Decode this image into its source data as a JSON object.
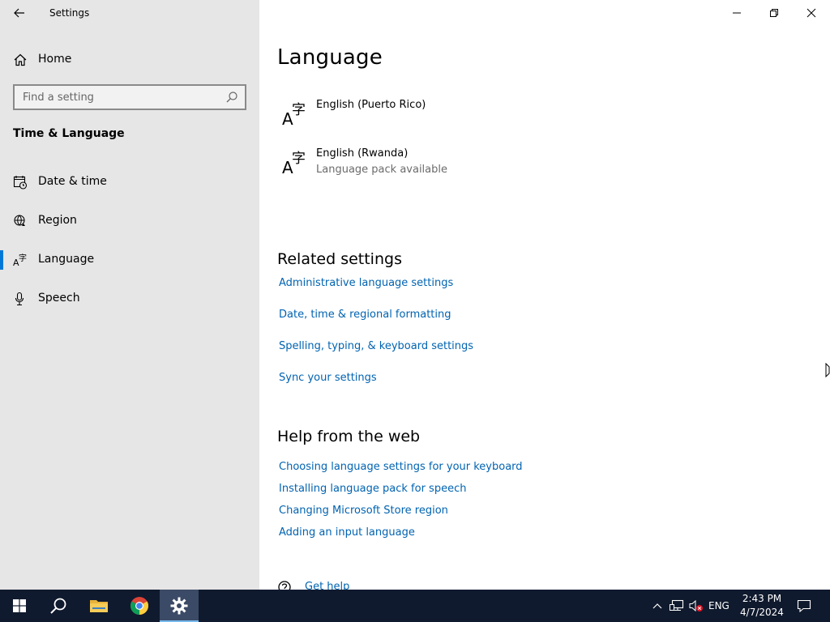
{
  "window": {
    "title": "Settings",
    "controls": {
      "minimize": "minimize",
      "maximize": "restore",
      "close": "close"
    }
  },
  "sidebar": {
    "home_label": "Home",
    "search_placeholder": "Find a setting",
    "section_title": "Time & Language",
    "items": [
      {
        "label": "Date & time",
        "icon": "calendar-clock-icon"
      },
      {
        "label": "Region",
        "icon": "globe-icon"
      },
      {
        "label": "Language",
        "icon": "language-icon",
        "active": true
      },
      {
        "label": "Speech",
        "icon": "microphone-icon"
      }
    ]
  },
  "main": {
    "title": "Language",
    "languages": [
      {
        "name": "English (Puerto Rico)",
        "subtitle": ""
      },
      {
        "name": "English (Rwanda)",
        "subtitle": "Language pack available"
      }
    ],
    "related": {
      "title": "Related settings",
      "links": [
        "Administrative language settings",
        "Date, time & regional formatting",
        "Spelling, typing, & keyboard settings",
        "Sync your settings"
      ]
    },
    "help": {
      "title": "Help from the web",
      "links": [
        "Choosing language settings for your keyboard",
        "Installing language pack for speech",
        "Changing Microsoft Store region",
        "Adding an input language"
      ]
    },
    "get_help": "Get help"
  },
  "taskbar": {
    "language": "ENG",
    "time": "2:43 PM",
    "date": "4/7/2024",
    "accent": "#76b9ed"
  },
  "colors": {
    "link": "#0063b1",
    "accent": "#0078d7",
    "sidebar": "#e6e6e6",
    "taskbar": "#101a2e"
  }
}
